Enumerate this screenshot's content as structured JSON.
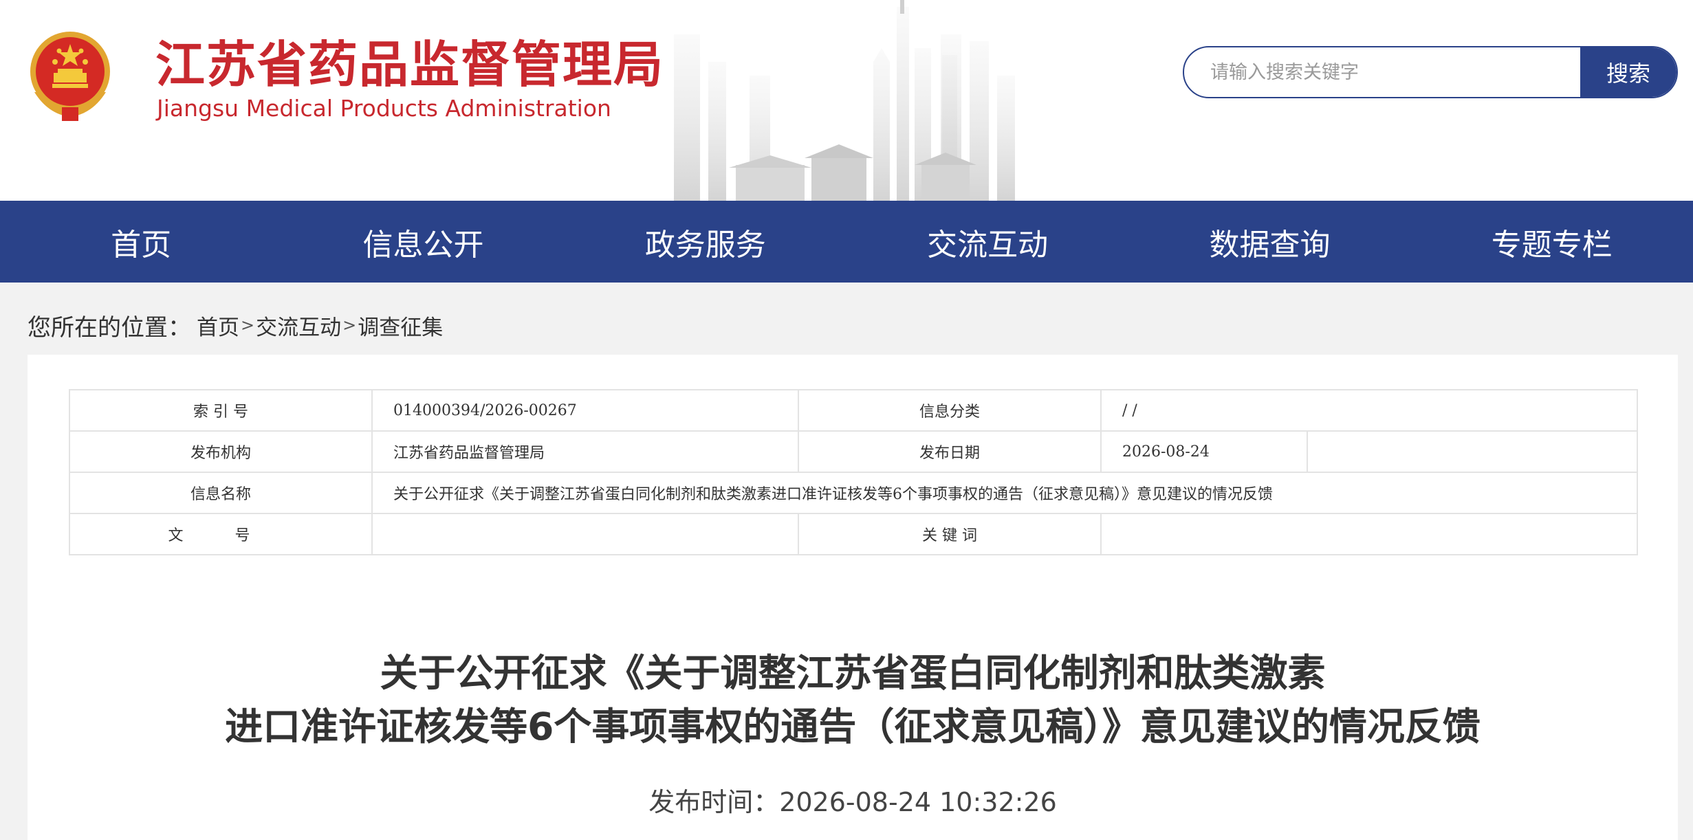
{
  "header": {
    "title_cn": "江苏省药品监督管理局",
    "title_en": "Jiangsu Medical Products Administration",
    "emblem_icon": "national-emblem-icon",
    "brand_red": "#c8282e",
    "brand_blue": "#2a4289"
  },
  "search": {
    "placeholder": "请输入搜索关键字",
    "button_label": "搜索"
  },
  "nav": {
    "items": [
      {
        "label": "首页"
      },
      {
        "label": "信息公开"
      },
      {
        "label": "政务服务"
      },
      {
        "label": "交流互动"
      },
      {
        "label": "数据查询"
      },
      {
        "label": "专题专栏"
      }
    ]
  },
  "breadcrumb": {
    "prefix": "您所在的位置：",
    "items": [
      "首页",
      "交流互动",
      "调查征集"
    ],
    "separator": ">"
  },
  "meta": {
    "index_label": "索 引 号",
    "index_value": "014000394/2026-00267",
    "category_label": "信息分类",
    "category_value": "/ /",
    "publisher_label": "发布机构",
    "publisher_value": "江苏省药品监督管理局",
    "date_label": "发布日期",
    "date_value": "2026-08-24",
    "name_label": "信息名称",
    "name_value": "关于公开征求《关于调整江苏省蛋白同化制剂和肽类激素进口准许证核发等6个事项事权的通告（征求意见稿）》意见建议的情况反馈",
    "docno_label": "文 号",
    "docno_value": "",
    "keywords_label": "关 键 词",
    "keywords_value": ""
  },
  "article": {
    "title_line1": "关于公开征求《关于调整江苏省蛋白同化制剂和肽类激素",
    "title_line2": "进口准许证核发等6个事项事权的通告（征求意见稿）》意见建议的情况反馈",
    "publish_time": "发布时间：2026-08-24 10:32:26"
  }
}
